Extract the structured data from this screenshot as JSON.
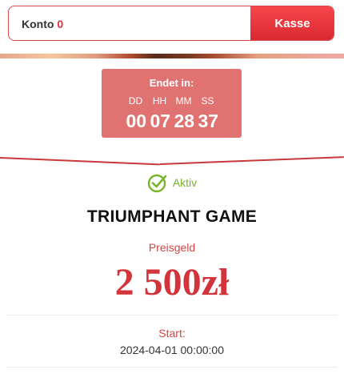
{
  "account": {
    "konto_label": "Konto",
    "konto_value": "0",
    "kasse_label": "Kasse"
  },
  "countdown": {
    "title": "Endet in:",
    "units": [
      "DD",
      "HH",
      "MM",
      "SS"
    ],
    "values": [
      "00",
      "07",
      "28",
      "37"
    ]
  },
  "status": {
    "text": "Aktiv",
    "icon": "check-circle-icon",
    "color": "#78b52b"
  },
  "game": {
    "title": "TRIUMPHANT GAME"
  },
  "prize": {
    "label": "Preisgeld",
    "amount": "2 500zł"
  },
  "start": {
    "label": "Start:",
    "value": "2024-04-01 00:00:00"
  },
  "colors": {
    "accent": "#d1343a",
    "countdown_bg": "#e07372",
    "success": "#78b52b"
  }
}
